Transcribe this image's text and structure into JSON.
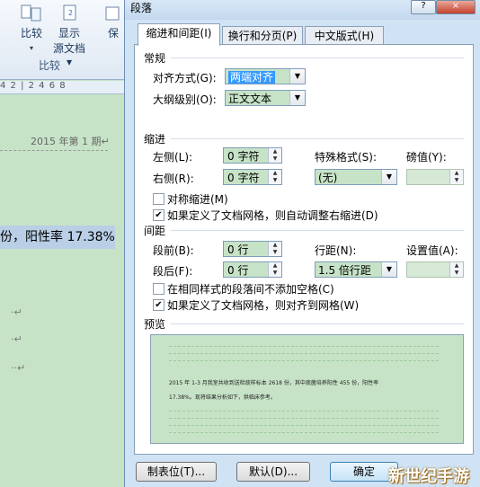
{
  "ribbon": {
    "buttons": [
      {
        "label_line1": "比较",
        "label_line2": "▾"
      },
      {
        "label_line1": "显示",
        "label_line2": "源文档 ▾"
      },
      {
        "label_line1": "保"
      }
    ],
    "group_label": "比较"
  },
  "ruler_text": "4  2  |  2  4  6  8",
  "document": {
    "header_text": "2015 年第 1 期↵",
    "highlight_text": "份，阳性率 17.38%。",
    "marks": [
      "·↵",
      "·↵",
      "··↵"
    ]
  },
  "dialog": {
    "title": "段落",
    "window_buttons": [
      "?",
      "×"
    ],
    "tabs": [
      "缩进和间距(I)",
      "换行和分页(P)",
      "中文版式(H)"
    ],
    "general": {
      "section": "常规",
      "alignment_label": "对齐方式(G):",
      "alignment_value": "两端对齐",
      "outline_label": "大纲级别(O):",
      "outline_value": "正文文本"
    },
    "indent": {
      "section": "缩进",
      "left_label": "左侧(L):",
      "left_value": "0 字符",
      "right_label": "右侧(R):",
      "right_value": "0 字符",
      "special_label": "特殊格式(S):",
      "special_value": "(无)",
      "by_label": "磅值(Y):",
      "mirror_label": "对称缩进(M)",
      "mirror_checked": false,
      "auto_right_label": "如果定义了文档网格，则自动调整右缩进(D)",
      "auto_right_checked": true
    },
    "spacing": {
      "section": "间距",
      "before_label": "段前(B):",
      "before_value": "0 行",
      "after_label": "段后(F):",
      "after_value": "0 行",
      "line_label": "行距(N):",
      "line_value": "1.5 倍行距",
      "at_label": "设置值(A):",
      "no_space_label": "在相同样式的段落间不添加空格(C)",
      "no_space_checked": false,
      "snap_label": "如果定义了文档网格，则对齐到网格(W)",
      "snap_checked": true
    },
    "preview": {
      "section": "预览",
      "line1": "2015 年 1-3 月我室共收到送检痰样标本 2618 份，其中痰菌培养阳性 455 份，阳性率",
      "line2": "17.38%。现将结果分析如下，供临床参考。"
    },
    "buttons": {
      "tabs_button": "制表位(T)...",
      "default_button": "默认(D)...",
      "ok_button": "确定"
    }
  },
  "watermark": "新世纪手游"
}
